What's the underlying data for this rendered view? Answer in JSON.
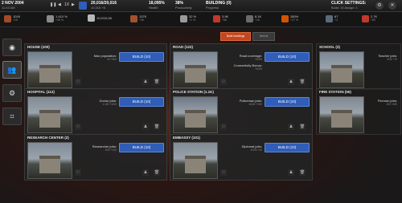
{
  "topbar": {
    "date": "2 NOV 2004",
    "time": "11:43 AM",
    "speed": "1X",
    "money_main": "20,016/20,016",
    "money_sub": "10,316 +8",
    "health": "18,095%",
    "health_label": "Health",
    "productivity": "38%",
    "productivity_label": "Productivity",
    "building_value": "BUILDING (0)",
    "building_label": "Progress",
    "click_settings": "CLICK SETTINGS:",
    "click_settings_sub": "Build: 10  Assign: 1"
  },
  "resources": [
    {
      "name": "wood-icon",
      "value": "101K",
      "sub": "+1K",
      "color": "#a34a2a"
    },
    {
      "name": "ammo-icon",
      "value": "1,410 %",
      "sub": "+46 %",
      "color": "#8a8a8a"
    },
    {
      "name": "stone-icon",
      "value": "10,0/10,0K",
      "sub": "",
      "color": "#b8b8b8"
    },
    {
      "name": "food-icon",
      "value": "137K",
      "sub": "+3K",
      "color": "#a0522d"
    },
    {
      "name": "metal-icon",
      "value": "32 %",
      "sub": "+1 %",
      "color": "#9a9a9a"
    },
    {
      "name": "fuel-icon",
      "value": "3.9K",
      "sub": "+58",
      "color": "#c0392b"
    },
    {
      "name": "parts-icon",
      "value": "8.1K",
      "sub": "+1K",
      "color": "#6a6a6a"
    },
    {
      "name": "research-icon",
      "value": "280%",
      "sub": "+27 %",
      "color": "#d35400"
    },
    {
      "name": "weapon-icon",
      "value": "67",
      "sub": "+4",
      "color": "#5a6a7a"
    },
    {
      "name": "medkit-icon",
      "value": "2.7K",
      "sub": "+80",
      "color": "#c0392b"
    }
  ],
  "tabs": {
    "active": "Build buildings",
    "inactive": "Sell lot"
  },
  "sidebar": [
    {
      "name": "compass-icon",
      "glyph": "◉"
    },
    {
      "name": "people-icon",
      "glyph": "👥"
    },
    {
      "name": "gear-icon",
      "glyph": "⚙"
    },
    {
      "name": "map-icon",
      "glyph": "⌗"
    }
  ],
  "cards": [
    {
      "title": "HOUSE (100)",
      "l1": "Max population:",
      "l1s": "94 +500",
      "l2": "",
      "l2s": "",
      "build": "BUILD (10)",
      "ghost": false
    },
    {
      "title": "ROAD (122)",
      "l1": "Road coverage:",
      "l1s": "+8.5%",
      "l2": "Connectivity Bonus:",
      "l2s": "+8.5%",
      "build": "BUILD (10)",
      "ghost": false
    },
    {
      "title": "SCHOOL (3)",
      "l1": "Teacher jobs:",
      "l1s": "0/40 +70",
      "l2": "",
      "l2s": "",
      "build": "BUILD (10)",
      "ghost": true
    },
    {
      "title": "HOSPITAL (112)",
      "l1": "Doctor jobs:",
      "l1s": "1,140 +1100",
      "l2": "",
      "l2s": "",
      "build": "BUILD (10)",
      "ghost": false
    },
    {
      "title": "POLICE STATION (1.1K)",
      "l1": "Policeman jobs:",
      "l1s": "10,6K +10K",
      "l2": "",
      "l2s": "",
      "build": "BUILD (10)",
      "ghost": false
    },
    {
      "title": "FIRE STATION (55)",
      "l1": "Fireman jobs:",
      "l1s": "220 +400",
      "l2": "",
      "l2s": "",
      "build": "BUILD (10)",
      "ghost": true
    },
    {
      "title": "RESEARCH CENTER (2)",
      "l1": "Researcher jobs:",
      "l1s": "0/20 +100",
      "l2": "",
      "l2s": "",
      "build": "BUILD (10)",
      "ghost": false
    },
    {
      "title": "EMBASSY (101)",
      "l1": "Diplomat jobs:",
      "l1s": "0/190 +30",
      "l2": "",
      "l2s": "",
      "build": "BUILD (10)",
      "ghost": false
    }
  ]
}
